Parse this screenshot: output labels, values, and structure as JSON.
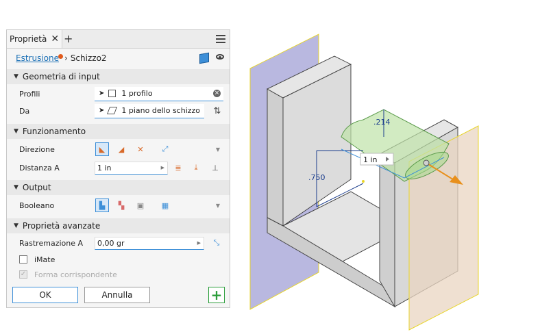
{
  "panel": {
    "tab_label": "Proprietà",
    "add_tab": "+",
    "breadcrumb": {
      "parent": "Estrusione",
      "current": "Schizzo2"
    }
  },
  "sections": {
    "input": "Geometria di input",
    "behavior": "Funzionamento",
    "output": "Output",
    "advanced": "Proprietà avanzate"
  },
  "fields": {
    "profiles_label": "Profili",
    "profiles_value": "1 profilo",
    "from_label": "Da",
    "from_value": "1 piano dello schizzo",
    "direction_label": "Direzione",
    "distance_label": "Distanza A",
    "distance_value": "1 in",
    "boolean_label": "Booleano",
    "taper_label": "Rastremazione A",
    "taper_value": "0,00 gr",
    "imate_label": "iMate",
    "match_shape_label": "Forma corrispondente"
  },
  "buttons": {
    "ok": "OK",
    "cancel": "Annulla"
  },
  "viewport": {
    "dim_214": ".214",
    "dim_750": ".750",
    "distance_input": "1 in"
  },
  "colors": {
    "accent": "#3d8fd8",
    "model_face": "#d9d9d9",
    "extrude_preview": "#bfe3a8",
    "orange_arrow": "#e8901c",
    "plane_blue": "#b9b8e0",
    "plane_orange": "#ead6c2"
  }
}
